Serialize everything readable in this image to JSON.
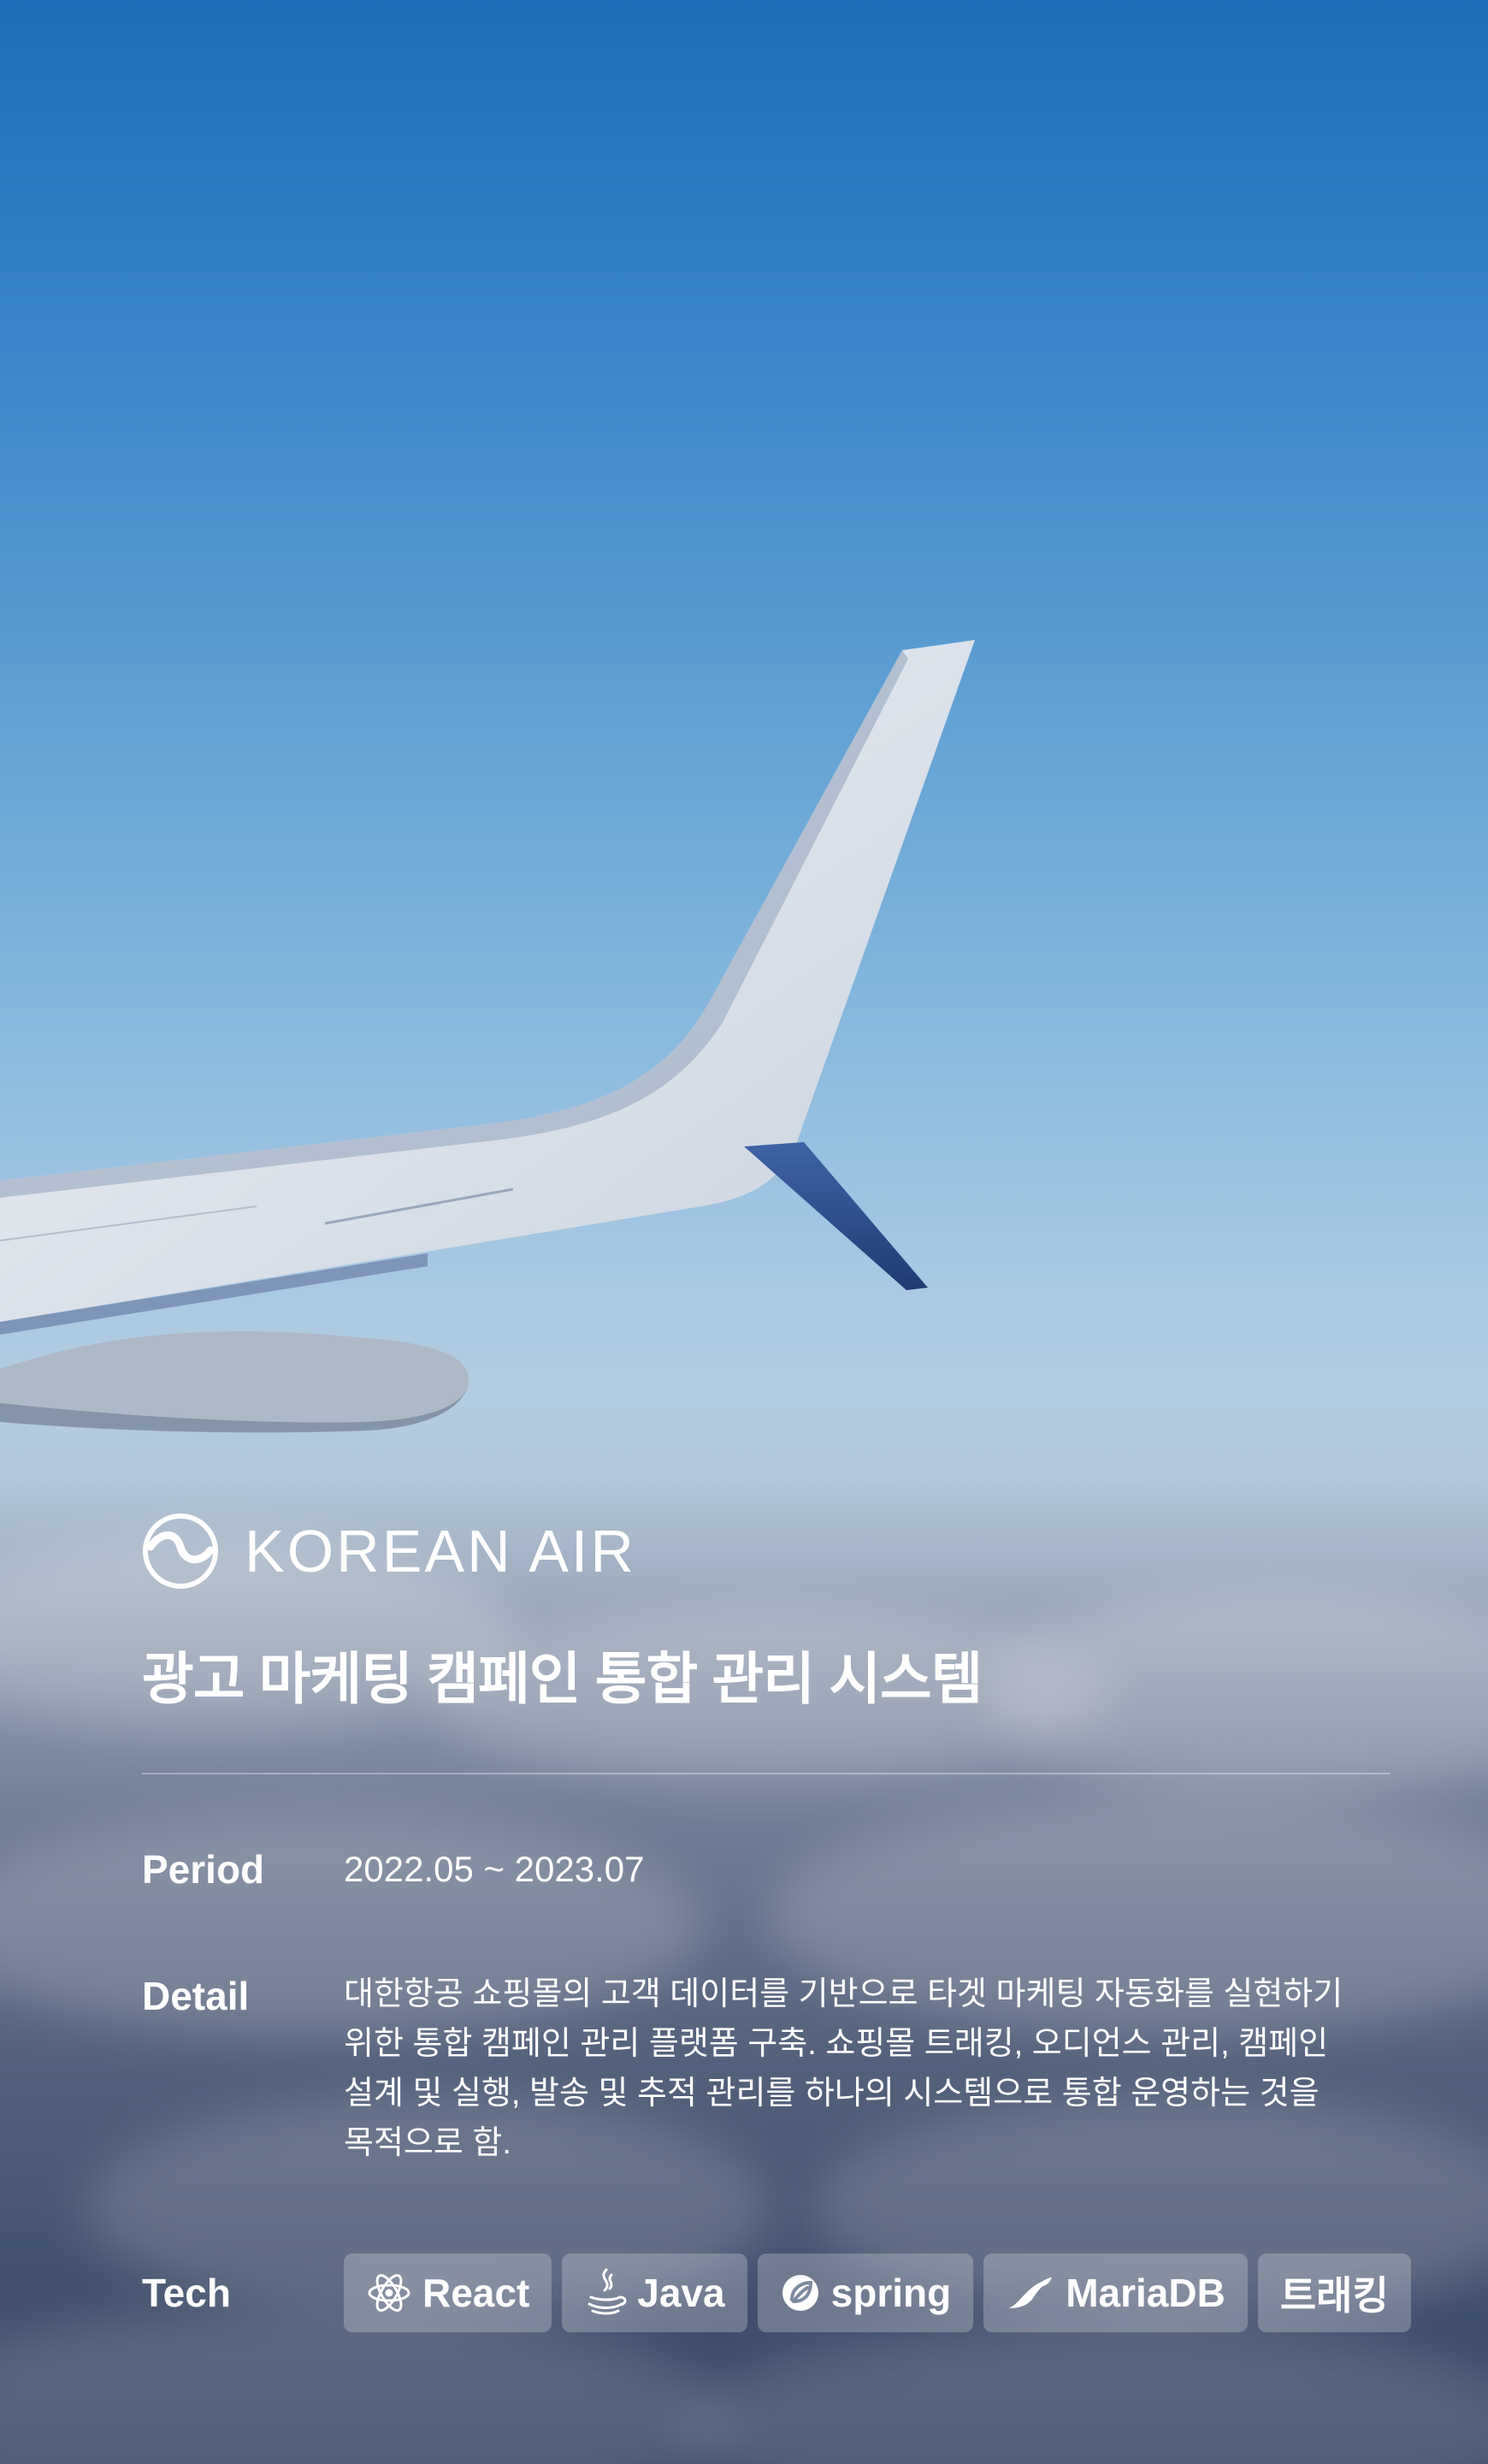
{
  "brand": {
    "name": "KOREAN AIR",
    "logo_icon": "korean-air-taeguk-logo"
  },
  "title": "광고 마케팅 캠페인 통합 관리 시스템",
  "period": {
    "label": "Period",
    "value": "2022.05 ~ 2023.07"
  },
  "detail": {
    "label": "Detail",
    "value": "대한항공 쇼핑몰의 고객 데이터를 기반으로 타겟 마케팅 자동화를 실현하기 위한 통합 캠페인 관리 플랫폼 구축. 쇼핑몰 트래킹, 오디언스 관리, 캠페인 설계 및 실행, 발송 및 추적 관리를 하나의 시스템으로 통합 운영하는 것을 목적으로 함."
  },
  "tech": {
    "label": "Tech",
    "tags": [
      {
        "label": "React",
        "icon": "react-icon"
      },
      {
        "label": "Java",
        "icon": "java-icon"
      },
      {
        "label": "spring",
        "icon": "spring-icon"
      },
      {
        "label": "MariaDB",
        "icon": "mariadb-icon"
      },
      {
        "label": "트래킹",
        "icon": ""
      }
    ]
  },
  "colors": {
    "sky_top": "#1f6cb6",
    "sky_horizon": "#bccfdf",
    "text": "#ffffff",
    "tag_bg": "rgba(255,255,255,0.24)"
  }
}
